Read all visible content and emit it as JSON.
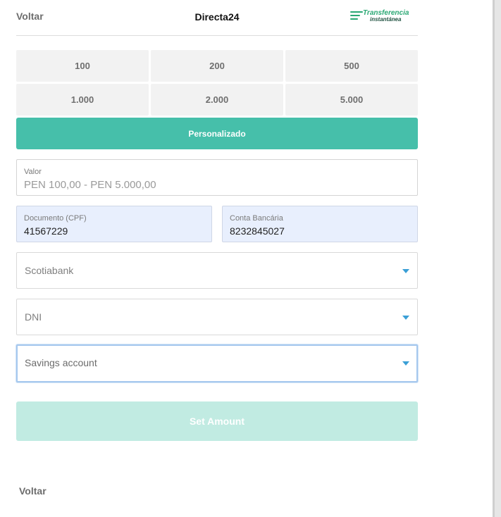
{
  "header": {
    "back_label": "Voltar",
    "title": "Directa24",
    "logo": {
      "line1": "Transferencia",
      "line2": "instantánea",
      "color": "#2aa874"
    }
  },
  "amounts": [
    "100",
    "200",
    "500",
    "1.000",
    "2.000",
    "5.000"
  ],
  "custom_label": "Personalizado",
  "value_field": {
    "label": "Valor",
    "placeholder": "PEN 100,00 - PEN 5.000,00"
  },
  "document_field": {
    "label": "Documento (CPF)",
    "value": "41567229"
  },
  "account_field": {
    "label": "Conta Bancária",
    "value": "8232845027"
  },
  "bank_select": {
    "value": "Scotiabank",
    "icon": "caret-down-icon"
  },
  "doc_type_select": {
    "value": "DNI",
    "icon": "caret-down-icon"
  },
  "account_type_select": {
    "value": "Savings account",
    "icon": "caret-down-icon"
  },
  "submit_label": "Set Amount",
  "footer": {
    "back_label": "Voltar"
  },
  "colors": {
    "accent": "#46bfaa",
    "disabled_accent": "#c1ebe2",
    "caret": "#3a9fd6",
    "filled_field": "#e8effd"
  }
}
